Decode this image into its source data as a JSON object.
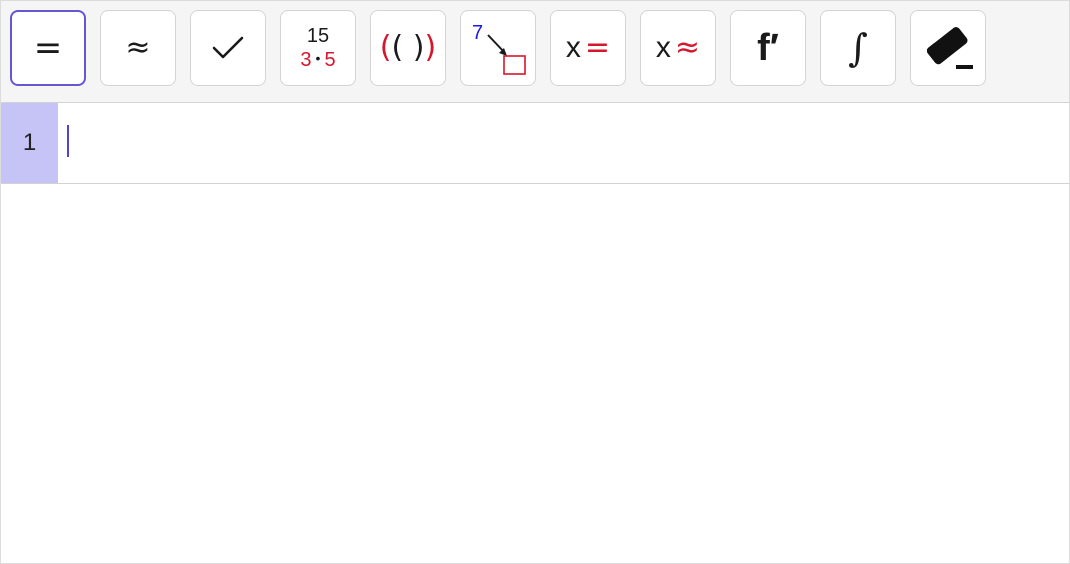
{
  "toolbar": {
    "tools": [
      {
        "id": "evaluate",
        "glyph": "=",
        "selected": true
      },
      {
        "id": "numeric",
        "glyph": "≈"
      },
      {
        "id": "keep-input",
        "icon": "checkmark-icon"
      },
      {
        "id": "factor",
        "top": "15",
        "bottom_left": "3",
        "bottom_right": "5",
        "dot": "•"
      },
      {
        "id": "expand",
        "outer_left": "(",
        "inner": "( )",
        "outer_right": ")"
      },
      {
        "id": "substitute",
        "number": "7",
        "icon": "substitute-arrow-icon"
      },
      {
        "id": "solve",
        "var": "x",
        "rel": "="
      },
      {
        "id": "nsolve",
        "var": "x",
        "rel": "≈"
      },
      {
        "id": "derivative",
        "glyph": "f′"
      },
      {
        "id": "integral",
        "glyph": "∫"
      },
      {
        "id": "delete",
        "icon": "eraser-icon"
      }
    ]
  },
  "rows": [
    {
      "number": "1",
      "input": ""
    }
  ],
  "colors": {
    "accent": "#6557d2",
    "row_highlight": "#c6c3f7",
    "red": "#d7152b",
    "blue": "#1a1ae0"
  }
}
